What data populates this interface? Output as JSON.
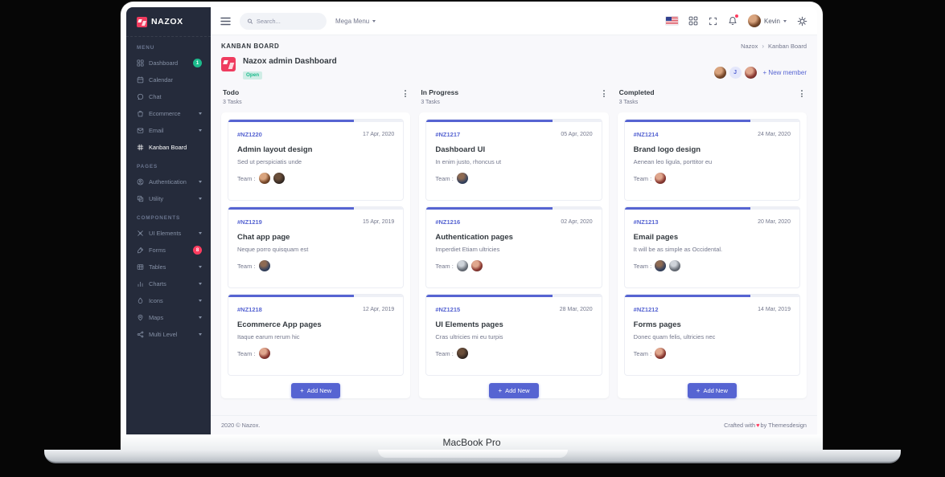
{
  "device": {
    "label": "MacBook Pro"
  },
  "brand": {
    "name": "NAZOX",
    "logo_color": "#ef3c5f"
  },
  "colors": {
    "primary": "#5664d2",
    "success": "#1cbb8c",
    "danger": "#ff3d60",
    "sidebar_bg": "#252b3b"
  },
  "topbar": {
    "search_placeholder": "Search...",
    "mega_menu": "Mega Menu",
    "user": "Kevin"
  },
  "sidebar": {
    "sections": [
      {
        "label": "MENU",
        "items": [
          {
            "label": "Dashboard",
            "icon": "dashboard-grid-icon",
            "badge": "1",
            "badge_style": "success"
          },
          {
            "label": "Calendar",
            "icon": "calendar-icon"
          },
          {
            "label": "Chat",
            "icon": "chat-icon"
          },
          {
            "label": "Ecommerce",
            "icon": "ecommerce-bag-icon",
            "chevron": true
          },
          {
            "label": "Email",
            "icon": "email-icon",
            "chevron": true
          },
          {
            "label": "Kanban Board",
            "icon": "kanban-icon",
            "active": true
          }
        ]
      },
      {
        "label": "PAGES",
        "items": [
          {
            "label": "Authentication",
            "icon": "user-circle-icon",
            "chevron": true
          },
          {
            "label": "Utility",
            "icon": "layers-icon",
            "chevron": true
          }
        ]
      },
      {
        "label": "COMPONENTS",
        "items": [
          {
            "label": "UI Elements",
            "icon": "ui-elements-icon",
            "chevron": true
          },
          {
            "label": "Forms",
            "icon": "pen-icon",
            "badge": "8",
            "badge_style": "danger"
          },
          {
            "label": "Tables",
            "icon": "table-icon",
            "chevron": true
          },
          {
            "label": "Charts",
            "icon": "chart-bars-icon",
            "chevron": true
          },
          {
            "label": "Icons",
            "icon": "droplet-icon",
            "chevron": true
          },
          {
            "label": "Maps",
            "icon": "map-pin-icon",
            "chevron": true
          },
          {
            "label": "Multi Level",
            "icon": "share-icon",
            "chevron": true
          }
        ]
      }
    ]
  },
  "page": {
    "heading": "KANBAN BOARD",
    "breadcrumb": [
      "Nazox",
      "Kanban Board"
    ],
    "project": {
      "name": "Nazox admin Dashboard",
      "status": "Open"
    },
    "team": [
      {
        "kind": "photo",
        "style": "av1"
      },
      {
        "kind": "initial",
        "label": "J"
      },
      {
        "kind": "photo",
        "style": "av4"
      }
    ],
    "new_member": "+ New member"
  },
  "board": {
    "add_new": "Add New",
    "columns": [
      {
        "name": "Todo",
        "count": "3 Tasks",
        "cards": [
          {
            "id": "#NZ1220",
            "date": "17 Apr, 2020",
            "title": "Admin layout design",
            "desc": "Sed ut perspiciatis unde",
            "team_label": "Team :",
            "team": [
              "av1",
              "av2"
            ],
            "progress": 72
          },
          {
            "id": "#NZ1219",
            "date": "15 Apr, 2019",
            "title": "Chat app page",
            "desc": "Neque porro quisquam est",
            "team_label": "Team :",
            "team": [
              "av3"
            ],
            "progress": 72
          },
          {
            "id": "#NZ1218",
            "date": "12 Apr, 2019",
            "title": "Ecommerce App pages",
            "desc": "Itaque earum rerum hic",
            "team_label": "Team :",
            "team": [
              "av4"
            ],
            "progress": 72
          }
        ]
      },
      {
        "name": "In Progress",
        "count": "3 Tasks",
        "cards": [
          {
            "id": "#NZ1217",
            "date": "05 Apr, 2020",
            "title": "Dashboard UI",
            "desc": "In enim justo, rhoncus ut",
            "team_label": "Team :",
            "team": [
              "av3"
            ],
            "progress": 72
          },
          {
            "id": "#NZ1216",
            "date": "02 Apr, 2020",
            "title": "Authentication pages",
            "desc": "Imperdiet Etiam ultricies",
            "team_label": "Team :",
            "team": [
              "av5",
              "av4"
            ],
            "progress": 72
          },
          {
            "id": "#NZ1215",
            "date": "28 Mar, 2020",
            "title": "UI Elements pages",
            "desc": "Cras ultricies mi eu turpis",
            "team_label": "Team :",
            "team": [
              "av2"
            ],
            "progress": 72
          }
        ]
      },
      {
        "name": "Completed",
        "count": "3 Tasks",
        "cards": [
          {
            "id": "#NZ1214",
            "date": "24 Mar, 2020",
            "title": "Brand logo design",
            "desc": "Aenean leo ligula, porttitor eu",
            "team_label": "Team :",
            "team": [
              "av4"
            ],
            "progress": 72
          },
          {
            "id": "#NZ1213",
            "date": "20 Mar, 2020",
            "title": "Email pages",
            "desc": "It will be as simple as Occidental.",
            "team_label": "Team :",
            "team": [
              "av3",
              "av5"
            ],
            "progress": 72
          },
          {
            "id": "#NZ1212",
            "date": "14 Mar, 2019",
            "title": "Forms pages",
            "desc": "Donec quam felis, ultricies nec",
            "team_label": "Team :",
            "team": [
              "av4"
            ],
            "progress": 72
          }
        ]
      }
    ]
  },
  "footer": {
    "left": "2020 © Nazox.",
    "right_prefix": "Crafted with",
    "right_heart": "♥",
    "right_suffix": "by Themesdesign"
  }
}
